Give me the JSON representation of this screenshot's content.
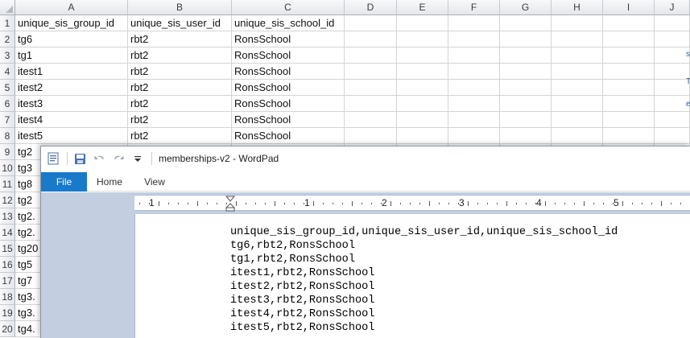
{
  "spreadsheet": {
    "columns": [
      "A",
      "B",
      "C",
      "D",
      "E",
      "F",
      "G",
      "H",
      "I",
      "J"
    ],
    "rows": [
      "1",
      "2",
      "3",
      "4",
      "5",
      "6",
      "7",
      "8",
      "9",
      "10",
      "11",
      "12",
      "13",
      "14",
      "15",
      "16",
      "17",
      "18",
      "19",
      "20"
    ],
    "cells": [
      [
        "unique_sis_group_id",
        "unique_sis_user_id",
        "unique_sis_school_id"
      ],
      [
        "tg6",
        "rbt2",
        "RonsSchool"
      ],
      [
        "tg1",
        "rbt2",
        "RonsSchool"
      ],
      [
        "itest1",
        "rbt2",
        "RonsSchool"
      ],
      [
        "itest2",
        "rbt2",
        "RonsSchool"
      ],
      [
        "itest3",
        "rbt2",
        "RonsSchool"
      ],
      [
        "itest4",
        "rbt2",
        "RonsSchool"
      ],
      [
        "itest5",
        "rbt2",
        "RonsSchool"
      ],
      [
        "tg2",
        "",
        ""
      ],
      [
        "tg3",
        "",
        ""
      ],
      [
        "tg8",
        "",
        ""
      ],
      [
        "tg2",
        "",
        ""
      ],
      [
        "tg2.",
        "",
        ""
      ],
      [
        "tg2.",
        "",
        ""
      ],
      [
        "tg20",
        "",
        ""
      ],
      [
        "tg5",
        "",
        ""
      ],
      [
        "tg7",
        "",
        ""
      ],
      [
        "tg3.",
        "",
        ""
      ],
      [
        "tg3.",
        "",
        ""
      ],
      [
        "tg4.",
        "",
        ""
      ]
    ],
    "edge_fragments": [
      "s",
      "T",
      "e"
    ]
  },
  "wordpad": {
    "title": "memberships-v2 - WordPad",
    "tabs": [
      "File",
      "Home",
      "View"
    ],
    "ruler_numbers": [
      "1",
      "1",
      "2",
      "3",
      "4",
      "5"
    ],
    "document_lines": [
      "unique_sis_group_id,unique_sis_user_id,unique_sis_school_id",
      "tg6,rbt2,RonsSchool",
      "tg1,rbt2,RonsSchool",
      "itest1,rbt2,RonsSchool",
      "itest2,rbt2,RonsSchool",
      "itest3,rbt2,RonsSchool",
      "itest4,rbt2,RonsSchool",
      "itest5,rbt2,RonsSchool"
    ],
    "icons": [
      "wordpad-app-icon",
      "save-icon",
      "undo-icon",
      "redo-icon",
      "customize-quick-access-icon"
    ],
    "colors": {
      "file_tab": "#1979ca",
      "workspace": "#c3cfe0"
    }
  }
}
